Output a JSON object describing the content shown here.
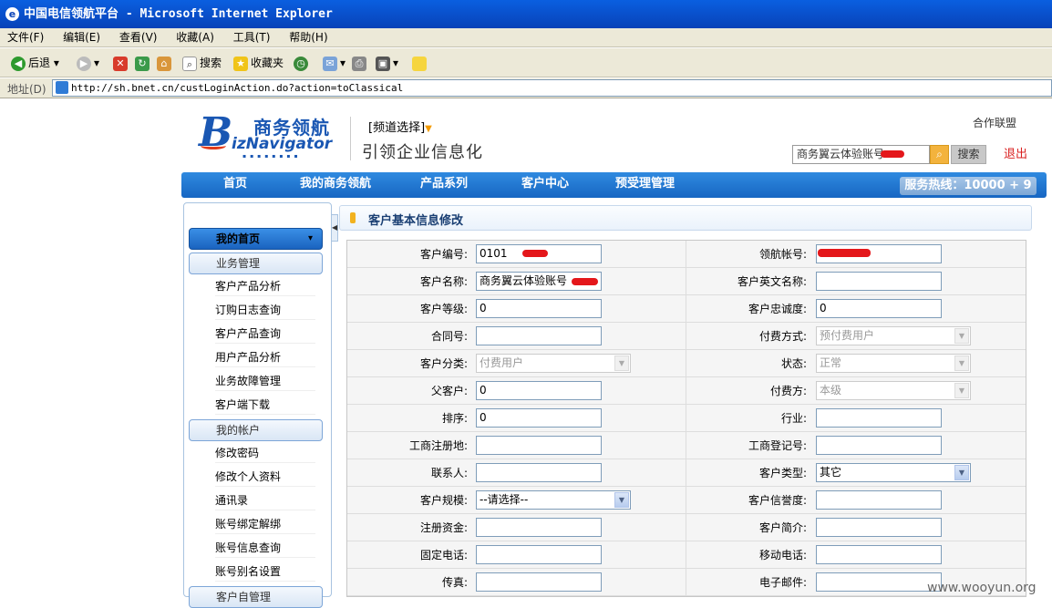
{
  "window": {
    "title": "中国电信领航平台 - Microsoft Internet Explorer"
  },
  "menubar": [
    "文件(F)",
    "编辑(E)",
    "查看(V)",
    "收藏(A)",
    "工具(T)",
    "帮助(H)"
  ],
  "toolbar": {
    "back": "后退",
    "search": "搜索",
    "favorites": "收藏夹"
  },
  "address": {
    "label": "地址(D)",
    "url": "http://sh.bnet.cn/custLoginAction.do?action=toClassical"
  },
  "header": {
    "logo_cn": "商务领航",
    "logo_en": "izNavigator",
    "logo_b": "B",
    "channel": "[频道选择]",
    "slogan": "引领企业信息化",
    "partner": "合作联盟",
    "search_value": "商务翼云体验账号",
    "search_button": "搜索",
    "logout": "退出"
  },
  "nav": {
    "items": [
      "首页",
      "我的商务领航",
      "产品系列",
      "客户中心",
      "预受理管理"
    ],
    "hotline": "服务热线：10000 + 9"
  },
  "sidebar": {
    "active": "我的首页",
    "groups": [
      {
        "label": "业务管理",
        "items": [
          "客户产品分析",
          "订购日志查询",
          "客户产品查询",
          "用户产品分析",
          "业务故障管理",
          "客户端下载"
        ]
      },
      {
        "label": "我的帐户",
        "items": [
          "修改密码",
          "修改个人资料",
          "通讯录",
          "账号绑定解绑",
          "账号信息查询",
          "账号别名设置"
        ]
      },
      {
        "label": "客户自管理",
        "items": []
      }
    ]
  },
  "main": {
    "title": "客户基本信息修改"
  },
  "form": {
    "rows": [
      {
        "l": "客户编号:",
        "lv": "0101",
        "r": "领航帐号:",
        "rv": ""
      },
      {
        "l": "客户名称:",
        "lv": "商务翼云体验账号",
        "r": "客户英文名称:",
        "rv": ""
      },
      {
        "l": "客户等级:",
        "lv": "0",
        "r": "客户忠诚度:",
        "rv": "0"
      },
      {
        "l": "合同号:",
        "lv": "",
        "r": "付费方式:",
        "rv": "预付费用户"
      },
      {
        "l": "客户分类:",
        "lv": "付费用户",
        "r": "状态:",
        "rv": "正常"
      },
      {
        "l": "父客户:",
        "lv": "0",
        "r": "付费方:",
        "rv": "本级"
      },
      {
        "l": "排序:",
        "lv": "0",
        "r": "行业:",
        "rv": ""
      },
      {
        "l": "工商注册地:",
        "lv": "",
        "r": "工商登记号:",
        "rv": ""
      },
      {
        "l": "联系人:",
        "lv": "",
        "r": "客户类型:",
        "rv": "其它"
      },
      {
        "l": "客户规模:",
        "lv": "--请选择--",
        "r": "客户信誉度:",
        "rv": ""
      },
      {
        "l": "注册资金:",
        "lv": "",
        "r": "客户简介:",
        "rv": ""
      },
      {
        "l": "固定电话:",
        "lv": "",
        "r": "移动电话:",
        "rv": ""
      },
      {
        "l": "传真:",
        "lv": "",
        "r": "电子邮件:",
        "rv": ""
      }
    ]
  },
  "watermark": "www.wooyun.org",
  "colors": {
    "accent": "#1766c2",
    "logout": "#d92020",
    "redaction": "#e4171b"
  }
}
